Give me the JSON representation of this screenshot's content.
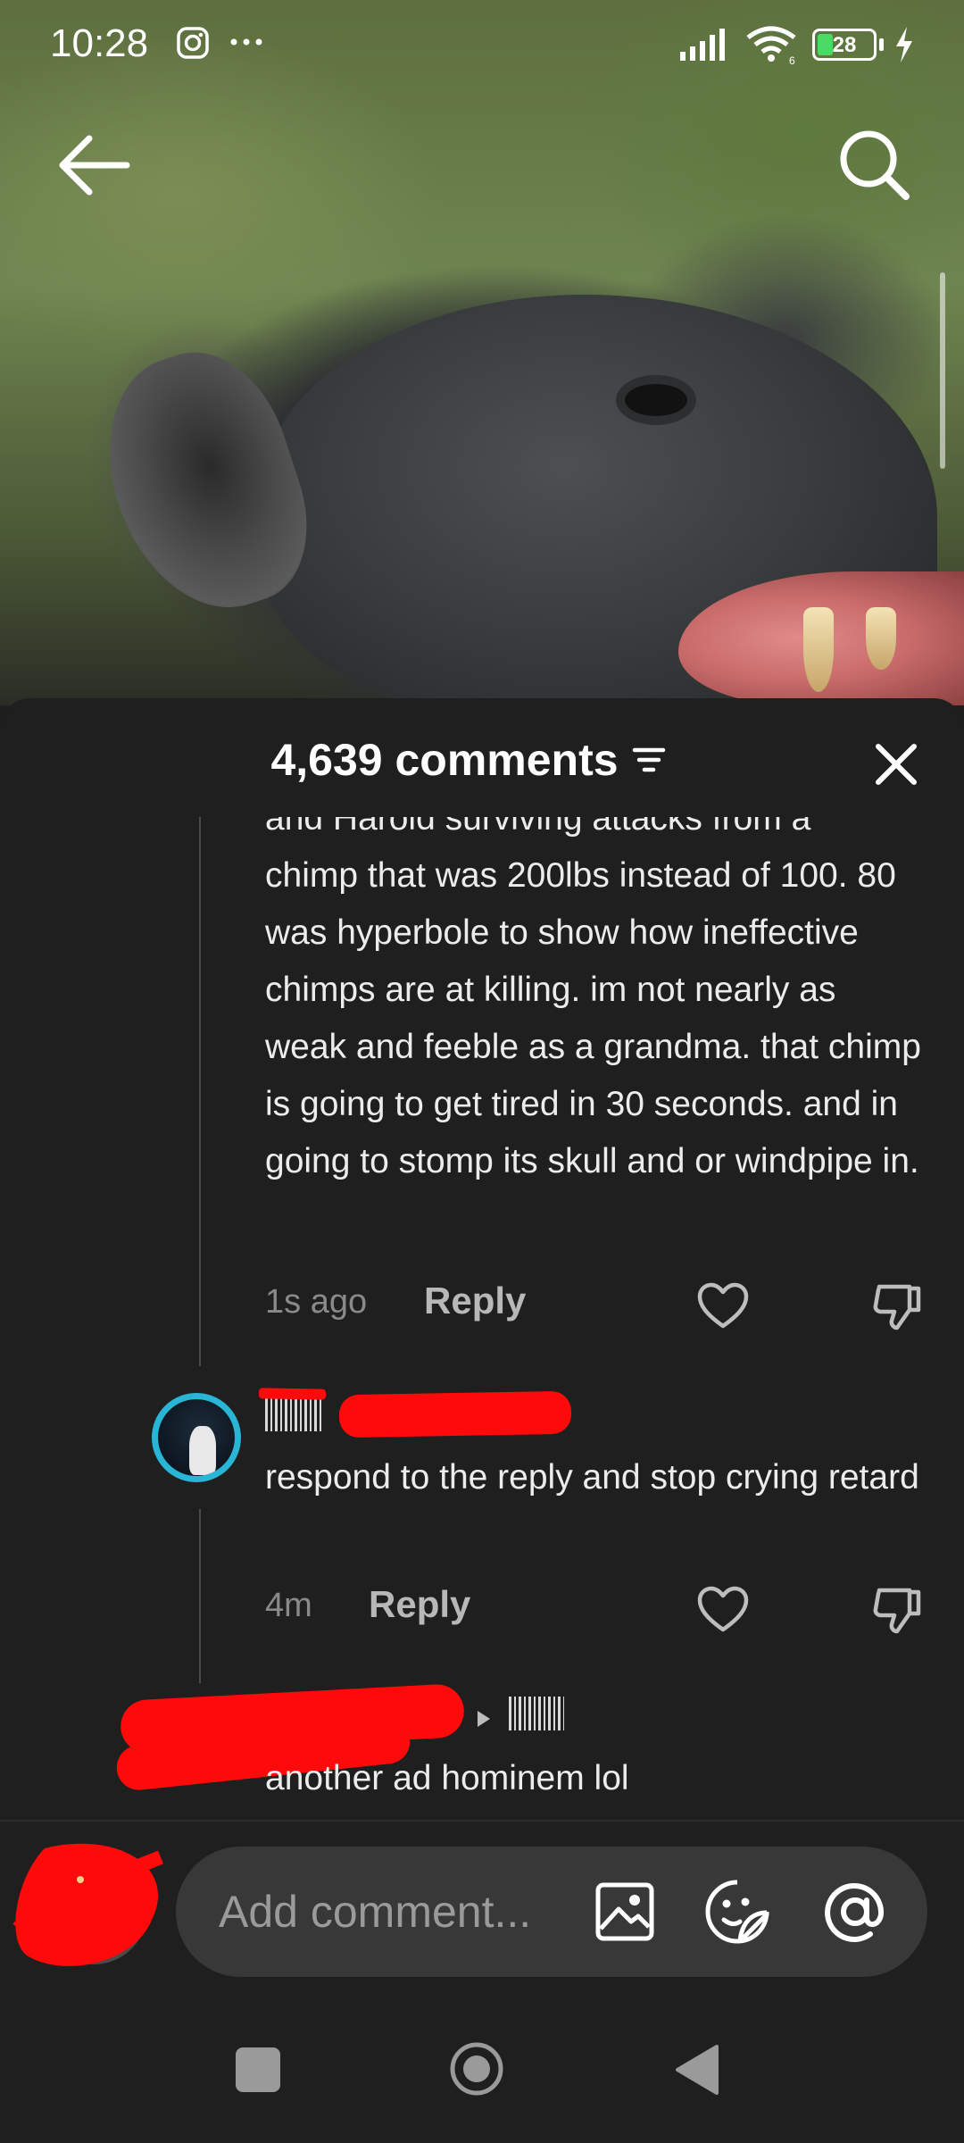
{
  "status_bar": {
    "time": "10:28",
    "battery_level": "28",
    "battery_fraction": 0.28,
    "icons": [
      "instagram-icon",
      "more-dots-icon",
      "signal-icon",
      "wifi-icon",
      "battery-icon",
      "charging-icon"
    ]
  },
  "header": {
    "back_icon": "arrow-left-icon",
    "search_icon": "search-icon"
  },
  "comments_sheet": {
    "title": "4,639 comments",
    "filter_icon": "filter-icon",
    "close_icon": "close-icon",
    "comments": [
      {
        "text_partial_top": "and Harold surviving attacks from a",
        "text": "chimp that was 200lbs instead of 100. 80 was hyperbole to show how ineffective chimps are at killing. im not nearly as weak and feeble as a grandma. that chimp is going to get tired in 30 seconds. and in going to stomp its skull and or windpipe in.",
        "time": "1s ago",
        "reply_label": "Reply"
      },
      {
        "username": "[redacted]",
        "text": "respond to the reply and stop crying retard",
        "time": "4m",
        "reply_label": "Reply"
      },
      {
        "username": "[redacted]",
        "text": "another ad hominem lol"
      }
    ]
  },
  "input_bar": {
    "placeholder": "Add comment...",
    "icons": [
      "image-icon",
      "emoji-icon",
      "mention-icon"
    ]
  },
  "nav_bar": {
    "icons": [
      "recents-square-icon",
      "home-circle-icon",
      "back-triangle-icon"
    ]
  },
  "colors": {
    "sheet_background": "#1f1f1f",
    "input_background": "#383838",
    "avatar_ring": "#29b6d6",
    "battery_fill": "#4cd964",
    "redaction": "#ff0a0a"
  }
}
